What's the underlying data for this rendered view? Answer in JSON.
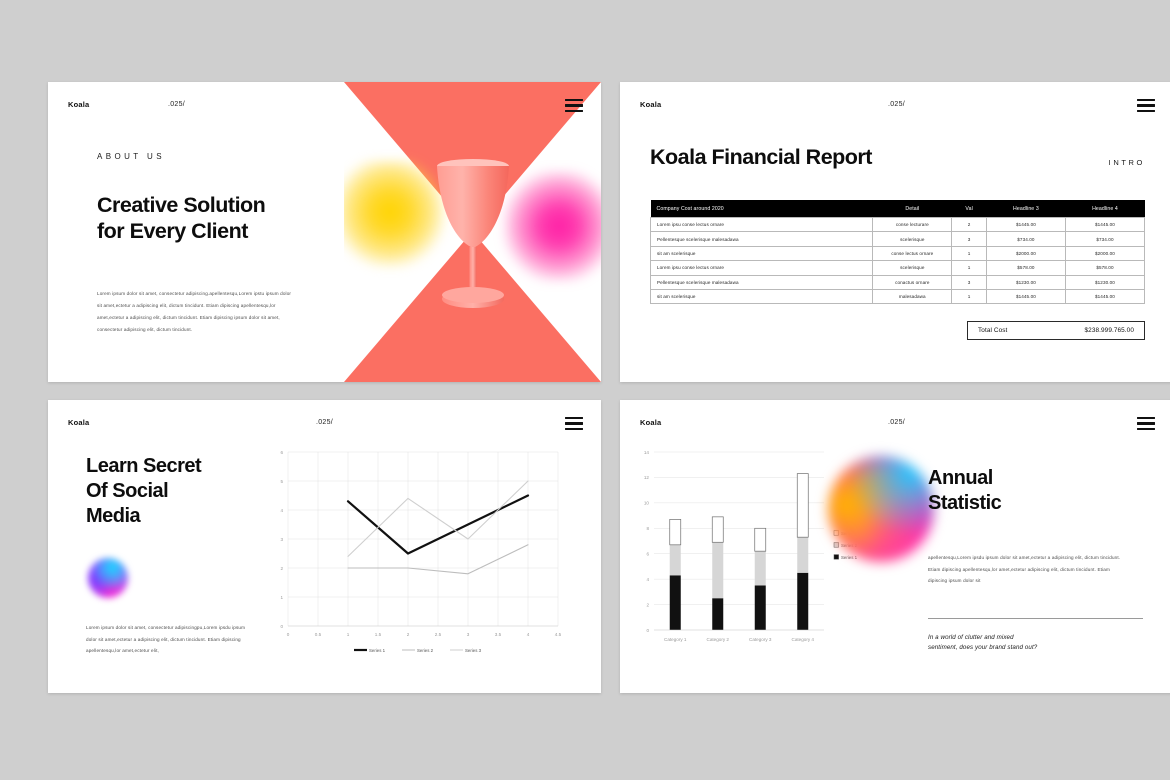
{
  "chrome": {
    "logo": "Koala",
    "number": ".025/",
    "menu_icon": "hamburger-icon"
  },
  "slide1": {
    "kicker": "ABOUT US",
    "title_line1": "Creative Solution",
    "title_line2": "for Every Client",
    "body": "Lorem ipsum dolor sit amet, consectetur adipiscing.apellentesqu,Lorem ipstu ipsum dolor sit amet,ectetur a adipiscing elit, dictum tincidunt. Etiam dipiscing apellentesqu,lor amet,ectetur a adipiscing elit, dictum tincidunt. Etiam dipiscing ipsum dolor sit amet, consectetur adipiscing elit, dictum tincidunt.",
    "art": {
      "shape": "bowtie-hourglass",
      "color": "#fb6f62",
      "glass_color": "#f98d85",
      "orb_left": "#ffd400",
      "orb_right": "#ff1fa5"
    }
  },
  "slide2": {
    "title": "Koala Financial Report",
    "label": "INTRO",
    "table": {
      "headers": [
        "Company Cost around 2020",
        "Detail",
        "Val",
        "Headline 3",
        "Headline 4"
      ],
      "rows": [
        [
          "Lorem ipsu conse lectus ornare",
          "conse lecturare",
          "2",
          "$1445.00",
          "$1445.00"
        ],
        [
          "Pellentesque scelerisque malesadawa",
          "scelerisque",
          "3",
          "$734.00",
          "$734.00"
        ],
        [
          "sit am scelerisque",
          "conse lectus ornare",
          "1",
          "$2000.00",
          "$2000.00"
        ],
        [
          "Lorem ipsu conse lectus ornare",
          "scelerisque",
          "1",
          "$578.00",
          "$578.00"
        ],
        [
          "Pellentesque scelerisque malesadawa",
          "conactus ornare",
          "3",
          "$1230.00",
          "$1230.00"
        ],
        [
          "sit am scelerisque",
          "malesadawa",
          "1",
          "$1445.00",
          "$1445.00"
        ]
      ]
    },
    "total_label": "Total Cost",
    "total_value": "$238.999.765.00"
  },
  "slide3": {
    "title_line1": "Learn Secret",
    "title_line2": "Of Social",
    "title_line3": "Media",
    "body": "Lorem ipsum dolor sit amet, consectetur adipiscingpu,Lorem ipsdu ipsum dolor sit amet,ectetur a adipiscing elit, dictum tincidunt. Etiam dipiscing apellentesqu,lor amet,ectetur elit,",
    "chart_data": {
      "type": "line",
      "title": "",
      "xlabel": "",
      "ylabel": "",
      "x": [
        1,
        2,
        3,
        4
      ],
      "xticks": [
        "0",
        "0.5",
        "1",
        "1.5",
        "2",
        "2.5",
        "3",
        "3.5",
        "4",
        "4.5"
      ],
      "yticks": [
        "0",
        "1",
        "2",
        "3",
        "4",
        "5",
        "6"
      ],
      "xlim": [
        0,
        4.5
      ],
      "ylim": [
        0,
        6
      ],
      "grid": true,
      "legend_position": "bottom",
      "series": [
        {
          "name": "Series 1",
          "values": [
            4.3,
            2.5,
            3.5,
            4.5
          ],
          "color": "#111111"
        },
        {
          "name": "Series 2",
          "values": [
            2.0,
            2.0,
            1.8,
            2.8
          ],
          "color": "#bdbdbd"
        },
        {
          "name": "Series 3",
          "values": [
            2.4,
            4.4,
            3.0,
            5.0
          ],
          "color": "#cfcfcf"
        }
      ]
    }
  },
  "slide4": {
    "title_line1": "Annual",
    "title_line2": "Statistic",
    "body": "apellentesqu,Lorem ipsdu ipsum dolor sit amet,ectetur a adipiscing elit, dictum tincidunt. Etiam dipiscing apellentesqu,lor amet,ectetur adipiscing elit, dictum tincidunt. Etiam dipiscing ipsum dolor sit",
    "quote_line1": "In a world of clutter and mixed",
    "quote_line2": "sentiment, does your brand stand out?",
    "chart_data": {
      "type": "bar",
      "stacked": true,
      "title": "",
      "xlabel": "",
      "ylabel": "",
      "categories": [
        "Category 1",
        "Category 2",
        "Category 3",
        "Category 4"
      ],
      "yticks": [
        "0",
        "2",
        "4",
        "6",
        "8",
        "10",
        "12",
        "14"
      ],
      "ylim": [
        0,
        14
      ],
      "grid": true,
      "legend_position": "right",
      "series": [
        {
          "name": "Series 1",
          "values": [
            4.3,
            2.5,
            3.5,
            4.5
          ],
          "color": "#111111"
        },
        {
          "name": "Series 2",
          "values": [
            2.4,
            4.4,
            2.7,
            2.8
          ],
          "color": "#d6d6d6"
        },
        {
          "name": "Series 3",
          "values": [
            2.0,
            2.0,
            1.8,
            5.0
          ],
          "color": "#ffffff"
        }
      ]
    }
  }
}
